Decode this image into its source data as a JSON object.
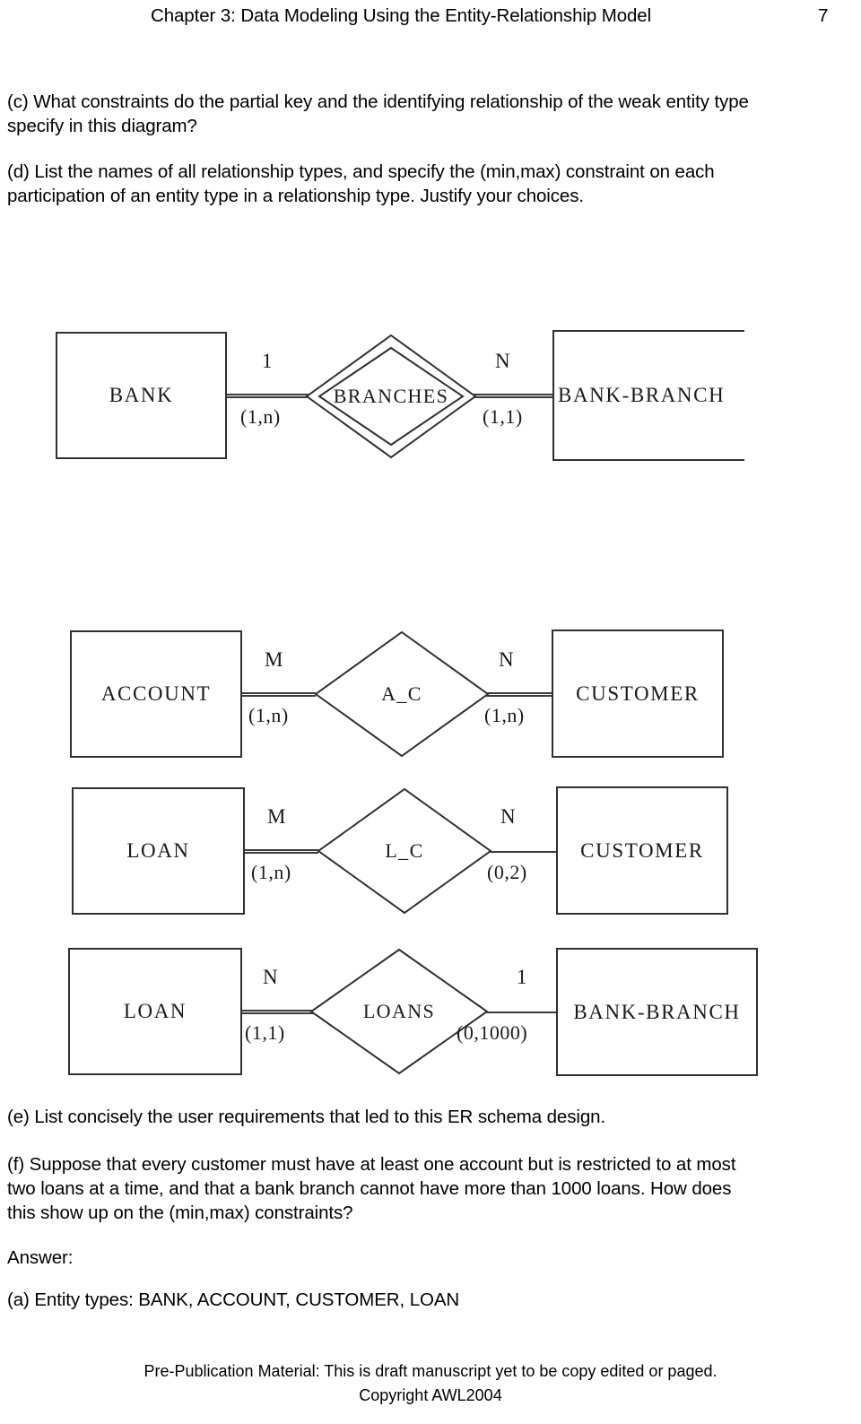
{
  "header": {
    "title": "Chapter 3: Data Modeling Using the Entity-Relationship Model",
    "page_number": "7"
  },
  "questions": {
    "c": "(c) What constraints do the partial key and the identifying relationship of the weak entity type specify in this diagram?",
    "d": "(d) List the names of all relationship types, and specify the (min,max) constraint on each participation of an entity type in a relationship type. Justify your choices.",
    "e": "(e) List concisely the user requirements that led to this ER schema design.",
    "f": "(f) Suppose that every customer must have at least one account but is restricted to at most two loans at a time, and that a bank branch cannot have more than 1000 loans. How does this show up on the (min,max) constraints?"
  },
  "answer": {
    "heading": "Answer:",
    "item_a": "(a) Entity types: BANK, ACCOUNT, CUSTOMER, LOAN"
  },
  "footer": {
    "line1": "Pre-Publication Material: This is draft manuscript yet to be copy edited or paged.",
    "line2": "Copyright AWL2004"
  },
  "diagrams": [
    {
      "id": "bank-branches",
      "left_entity": "BANK",
      "left_entity_kind": "strong",
      "relationship": "BRANCHES",
      "relationship_kind": "identifying",
      "right_entity": "BANK-BRANCH",
      "right_entity_kind": "weak",
      "left_ratio": "1",
      "left_minmax": "(1,n)",
      "left_line": "double",
      "right_ratio": "N",
      "right_minmax": "(1,1)",
      "right_line": "double"
    },
    {
      "id": "account-customer",
      "left_entity": "ACCOUNT",
      "left_entity_kind": "strong",
      "relationship": "A_C",
      "relationship_kind": "normal",
      "right_entity": "CUSTOMER",
      "right_entity_kind": "strong",
      "left_ratio": "M",
      "left_minmax": "(1,n)",
      "left_line": "double",
      "right_ratio": "N",
      "right_minmax": "(1,n)",
      "right_line": "double"
    },
    {
      "id": "loan-customer",
      "left_entity": "LOAN",
      "left_entity_kind": "strong",
      "relationship": "L_C",
      "relationship_kind": "normal",
      "right_entity": "CUSTOMER",
      "right_entity_kind": "strong",
      "left_ratio": "M",
      "left_minmax": "(1,n)",
      "left_line": "double",
      "right_ratio": "N",
      "right_minmax": "(0,2)",
      "right_line": "single"
    },
    {
      "id": "loan-bank-branch",
      "left_entity": "LOAN",
      "left_entity_kind": "strong",
      "relationship": "LOANS",
      "relationship_kind": "normal",
      "right_entity": "BANK-BRANCH",
      "right_entity_kind": "strong",
      "left_ratio": "N",
      "left_minmax": "(1,1)",
      "left_line": "double",
      "right_ratio": "1",
      "right_minmax": "(0,1000)",
      "right_line": "single"
    }
  ],
  "colors": {
    "ink": "#000000",
    "line": "#303030",
    "page": "#ffffff"
  }
}
